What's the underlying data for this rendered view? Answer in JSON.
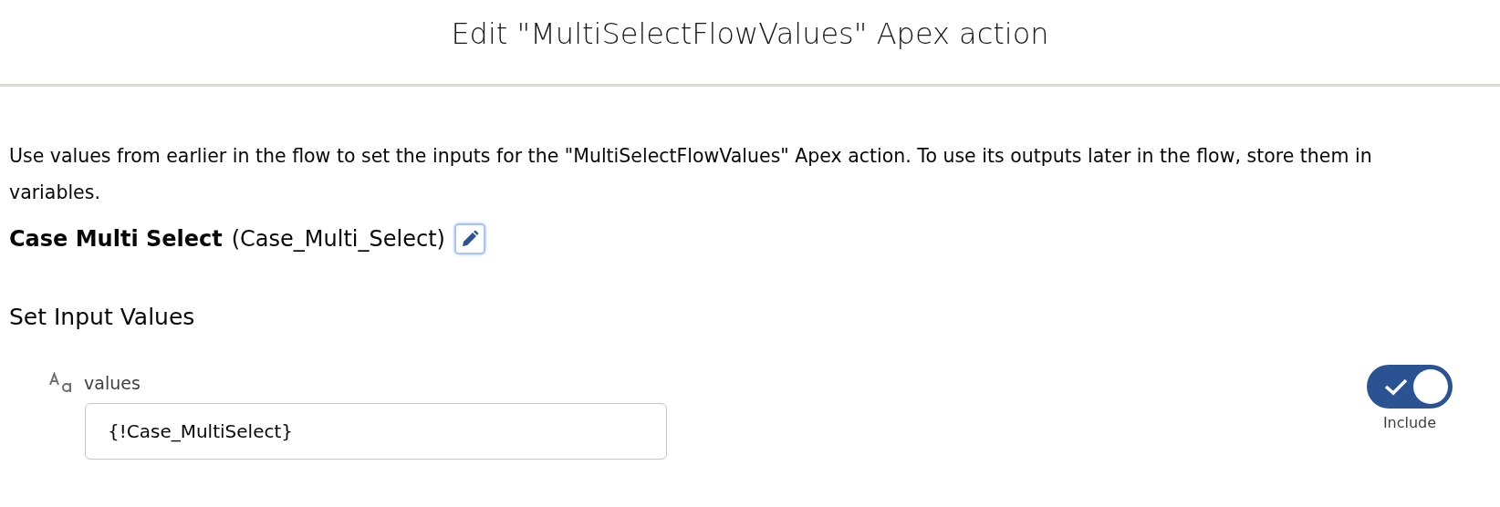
{
  "header": {
    "title": "Edit \"MultiSelectFlowValues\" Apex action"
  },
  "description": "Use values from earlier in the flow to set the inputs for the \"MultiSelectFlowValues\" Apex action. To use its outputs later in the flow, store them in variables.",
  "action": {
    "label": "Case Multi Select",
    "api_name": "(Case_Multi_Select)"
  },
  "section_title": "Set Input Values",
  "inputs": [
    {
      "label": "values",
      "value": "{!Case_MultiSelect}",
      "include": {
        "label": "Include",
        "on": true
      }
    }
  ]
}
